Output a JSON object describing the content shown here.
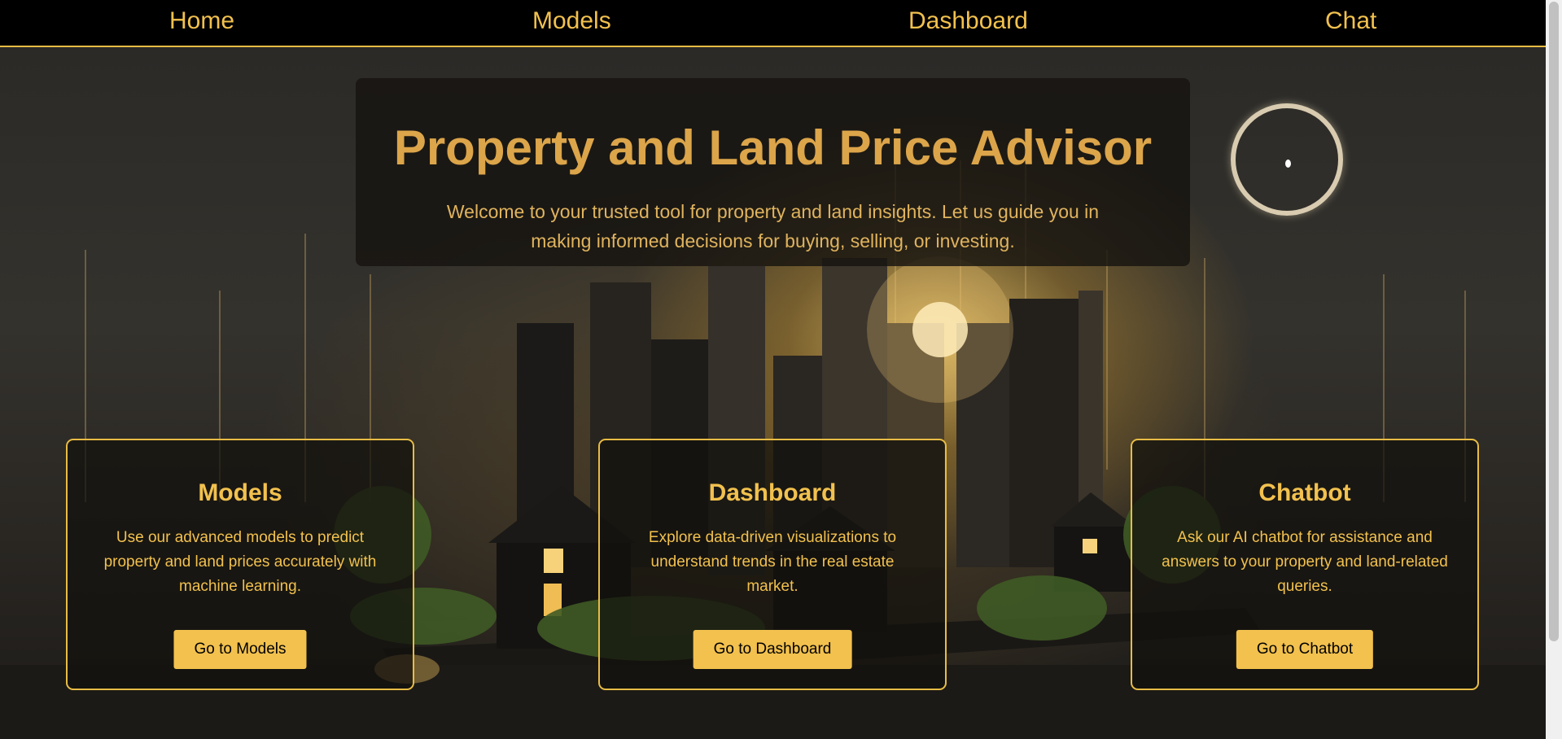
{
  "nav": {
    "items": [
      {
        "label": "Home"
      },
      {
        "label": "Models"
      },
      {
        "label": "Dashboard"
      },
      {
        "label": "Chat"
      }
    ]
  },
  "hero": {
    "title": "Property and Land Price Advisor",
    "subtitle": "Welcome to your trusted tool for property and land insights. Let us guide you in making informed decisions for buying, selling, or investing."
  },
  "cards": [
    {
      "title": "Models",
      "text": "Use our advanced models to predict property and land prices accurately with machine learning.",
      "button": "Go to Models"
    },
    {
      "title": "Dashboard",
      "text": "Explore data-driven visualizations to understand trends in the real estate market.",
      "button": "Go to Dashboard"
    },
    {
      "title": "Chatbot",
      "text": "Ask our AI chatbot for assistance and answers to your property and land-related queries.",
      "button": "Go to Chatbot"
    }
  ],
  "colors": {
    "accent": "#f2c14e",
    "title": "#dca54a",
    "nav_bg": "#000000"
  }
}
